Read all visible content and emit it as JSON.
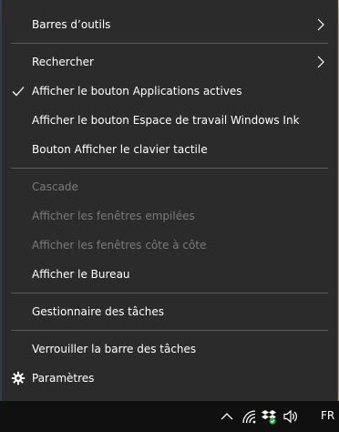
{
  "menu": {
    "items": [
      {
        "label": "Barres d’outils",
        "submenu": true,
        "checked": false,
        "disabled": false
      },
      {
        "label": "Rechercher",
        "submenu": true,
        "checked": false,
        "disabled": false
      },
      {
        "label": "Afficher le bouton Applications actives",
        "submenu": false,
        "checked": true,
        "disabled": false
      },
      {
        "label": "Afficher le bouton Espace de travail Windows Ink",
        "submenu": false,
        "checked": false,
        "disabled": false
      },
      {
        "label": "Bouton Afficher le clavier tactile",
        "submenu": false,
        "checked": false,
        "disabled": false
      },
      {
        "label": "Cascade",
        "submenu": false,
        "checked": false,
        "disabled": true
      },
      {
        "label": "Afficher les fenêtres empilées",
        "submenu": false,
        "checked": false,
        "disabled": true
      },
      {
        "label": "Afficher les fenêtres côte à côte",
        "submenu": false,
        "checked": false,
        "disabled": true
      },
      {
        "label": "Afficher le Bureau",
        "submenu": false,
        "checked": false,
        "disabled": false
      },
      {
        "label": "Gestionnaire des tâches",
        "submenu": false,
        "checked": false,
        "disabled": false
      },
      {
        "label": "Verrouiller la barre des tâches",
        "submenu": false,
        "checked": false,
        "disabled": false
      },
      {
        "label": "Paramètres",
        "submenu": false,
        "checked": false,
        "disabled": false,
        "icon": "gear-icon"
      }
    ]
  },
  "taskbar": {
    "language": "FR",
    "tray_icons": [
      "chevron-up-icon",
      "wifi-icon",
      "dropbox-icon",
      "volume-icon"
    ]
  },
  "colors": {
    "menu_bg": "#2b2b2b",
    "text": "#ffffff",
    "disabled_text": "#7a7a7a",
    "separator": "#5a5a5a",
    "taskbar_bg": "#101010"
  }
}
